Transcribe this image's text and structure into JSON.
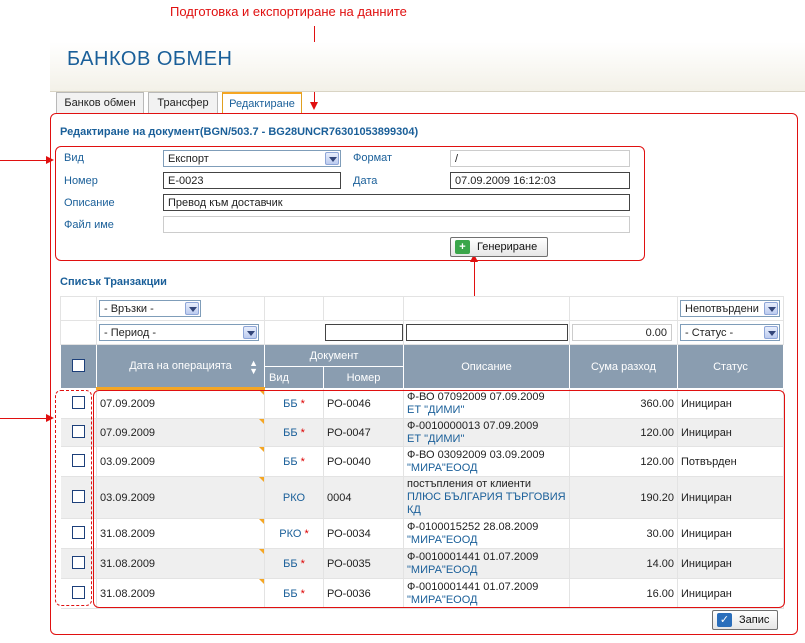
{
  "annotation": {
    "top_label": "Подготовка и  експортиране на данните"
  },
  "header": {
    "title": "БАНКОВ ОБМЕН"
  },
  "tabs": [
    {
      "label": "Банков обмен"
    },
    {
      "label": "Трансфер"
    },
    {
      "label": "Редактиране"
    }
  ],
  "document": {
    "title": "Редактиране на документ(BGN/503.7 - BG28UNCR76301053899304)",
    "vid_label": "Вид",
    "vid_value": "Експорт",
    "format_label": "Формат",
    "format_value": "/",
    "nomer_label": "Номер",
    "nomer_value": "Е-0023",
    "data_label": "Дата",
    "data_value": "07.09.2009 16:12:03",
    "opisanie_label": "Описание",
    "opisanie_value": "Превод към доставчик",
    "file_label": "Файл име",
    "file_value": "",
    "generate_label": "Генериране"
  },
  "transactions": {
    "title": "Списък Транзакции",
    "filters": {
      "links": "- Връзки -",
      "period": "- Период -",
      "amount": "0.00",
      "unconfirmed": "Непотвърдени",
      "status": "- Статус -"
    },
    "headers": {
      "date": "Дата на операцията",
      "document": "Документ",
      "vid": "Вид",
      "nomer": "Номер",
      "opisanie": "Описание",
      "suma": "Сума разход",
      "status": "Статус"
    },
    "rows": [
      {
        "date": "07.09.2009",
        "vid": "ББ",
        "star": "*",
        "nomer": "РО-0046",
        "desc1": "Ф-ВО 07092009 07.09.2009",
        "desc2": "ЕТ \"ДИМИ\"",
        "suma": "360.00",
        "status": "Инициран"
      },
      {
        "date": "07.09.2009",
        "vid": "ББ",
        "star": "*",
        "nomer": "РО-0047",
        "desc1": "Ф-0010000013 07.09.2009",
        "desc2": "ЕТ \"ДИМИ\"",
        "suma": "120.00",
        "status": "Инициран"
      },
      {
        "date": "03.09.2009",
        "vid": "ББ",
        "star": "*",
        "nomer": "РО-0040",
        "desc1": "Ф-ВО 03092009 03.09.2009",
        "desc2": "\"МИРА\"ЕООД",
        "suma": "120.00",
        "status": "Потвърден"
      },
      {
        "date": "03.09.2009",
        "vid": "РКО",
        "star": "",
        "nomer": "0004",
        "desc1": "постъпления от клиенти",
        "desc2": "ПЛЮС БЪЛГАРИЯ ТЪРГОВИЯ КД",
        "suma": "190.20",
        "status": "Инициран"
      },
      {
        "date": "31.08.2009",
        "vid": "РКО",
        "star": "*",
        "nomer": "РО-0034",
        "desc1": "Ф-0100015252 28.08.2009",
        "desc2": "\"МИРА\"ЕООД",
        "suma": "30.00",
        "status": "Инициран"
      },
      {
        "date": "31.08.2009",
        "vid": "ББ",
        "star": "*",
        "nomer": "РО-0035",
        "desc1": "Ф-0010001441 01.07.2009",
        "desc2": "\"МИРА\"ЕООД",
        "suma": "14.00",
        "status": "Инициран"
      },
      {
        "date": "31.08.2009",
        "vid": "ББ",
        "star": "*",
        "nomer": "РО-0036",
        "desc1": "Ф-0010001441 01.07.2009",
        "desc2": "\"МИРА\"ЕООД",
        "suma": "16.00",
        "status": "Инициран"
      }
    ],
    "save_label": "Запис"
  }
}
